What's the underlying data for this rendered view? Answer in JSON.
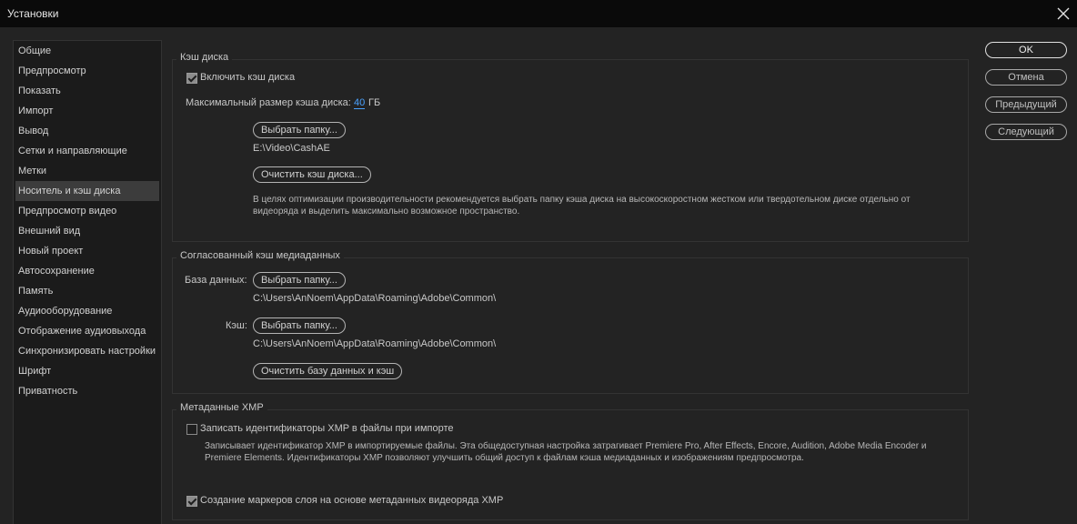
{
  "window": {
    "title": "Установки"
  },
  "sidebar": {
    "items": [
      {
        "label": "Общие"
      },
      {
        "label": "Предпросмотр"
      },
      {
        "label": "Показать"
      },
      {
        "label": "Импорт"
      },
      {
        "label": "Вывод"
      },
      {
        "label": "Сетки и направляющие"
      },
      {
        "label": "Метки"
      },
      {
        "label": "Носитель и кэш диска",
        "selected": true
      },
      {
        "label": "Предпросмотр видео"
      },
      {
        "label": "Внешний вид"
      },
      {
        "label": "Новый проект"
      },
      {
        "label": "Автосохранение"
      },
      {
        "label": "Память"
      },
      {
        "label": "Аудиооборудование"
      },
      {
        "label": "Отображение аудиовыхода"
      },
      {
        "label": "Синхронизировать настройки"
      },
      {
        "label": "Шрифт"
      },
      {
        "label": "Приватность"
      }
    ]
  },
  "buttons": {
    "ok": "OK",
    "cancel": "Отмена",
    "previous": "Предыдущий",
    "next": "Следующий"
  },
  "disk_cache": {
    "legend": "Кэш диска",
    "enable_label": "Включить кэш диска",
    "enabled": true,
    "max_size_label": "Максимальный размер кэша диска:",
    "max_size_value": "40",
    "max_size_unit": "ГБ",
    "choose_folder": "Выбрать папку...",
    "path": "E:\\Video\\CashAE",
    "clear_button": "Очистить кэш диска...",
    "hint_line1": "В целях оптимизации производительности рекомендуется выбрать папку кэша диска на высокоскоростном жестком или твердотельном диске отдельно от",
    "hint_line2": "видеоряда и выделить максимально возможное пространство."
  },
  "media_cache": {
    "legend": "Согласованный кэш медиаданных",
    "db_label": "База данных:",
    "db_choose": "Выбрать папку...",
    "db_path": "C:\\Users\\AnNoem\\AppData\\Roaming\\Adobe\\Common\\",
    "cache_label": "Кэш:",
    "cache_choose": "Выбрать папку...",
    "cache_path": "C:\\Users\\AnNoem\\AppData\\Roaming\\Adobe\\Common\\",
    "clear_button": "Очистить базу данных и кэш"
  },
  "xmp": {
    "legend": "Метаданные XMP",
    "write_label": "Записать идентификаторы XMP в файлы при импорте",
    "write_checked": false,
    "write_desc_line1": "Записывает идентификатор XMP в импортируемые файлы. Эта общедоступная настройка затрагивает Premiere Pro, After Effects, Encore, Audition, Adobe Media Encoder и",
    "write_desc_line2": "Premiere Elements. Идентификаторы XMP позволяют улучшить общий доступ к файлам кэша медиаданных и изображениям предпросмотра.",
    "markers_label": "Создание маркеров слоя на основе метаданных видеоряда XMP",
    "markers_checked": true
  },
  "icons": {
    "close": "close-icon",
    "checkmark": "checkmark-icon"
  }
}
